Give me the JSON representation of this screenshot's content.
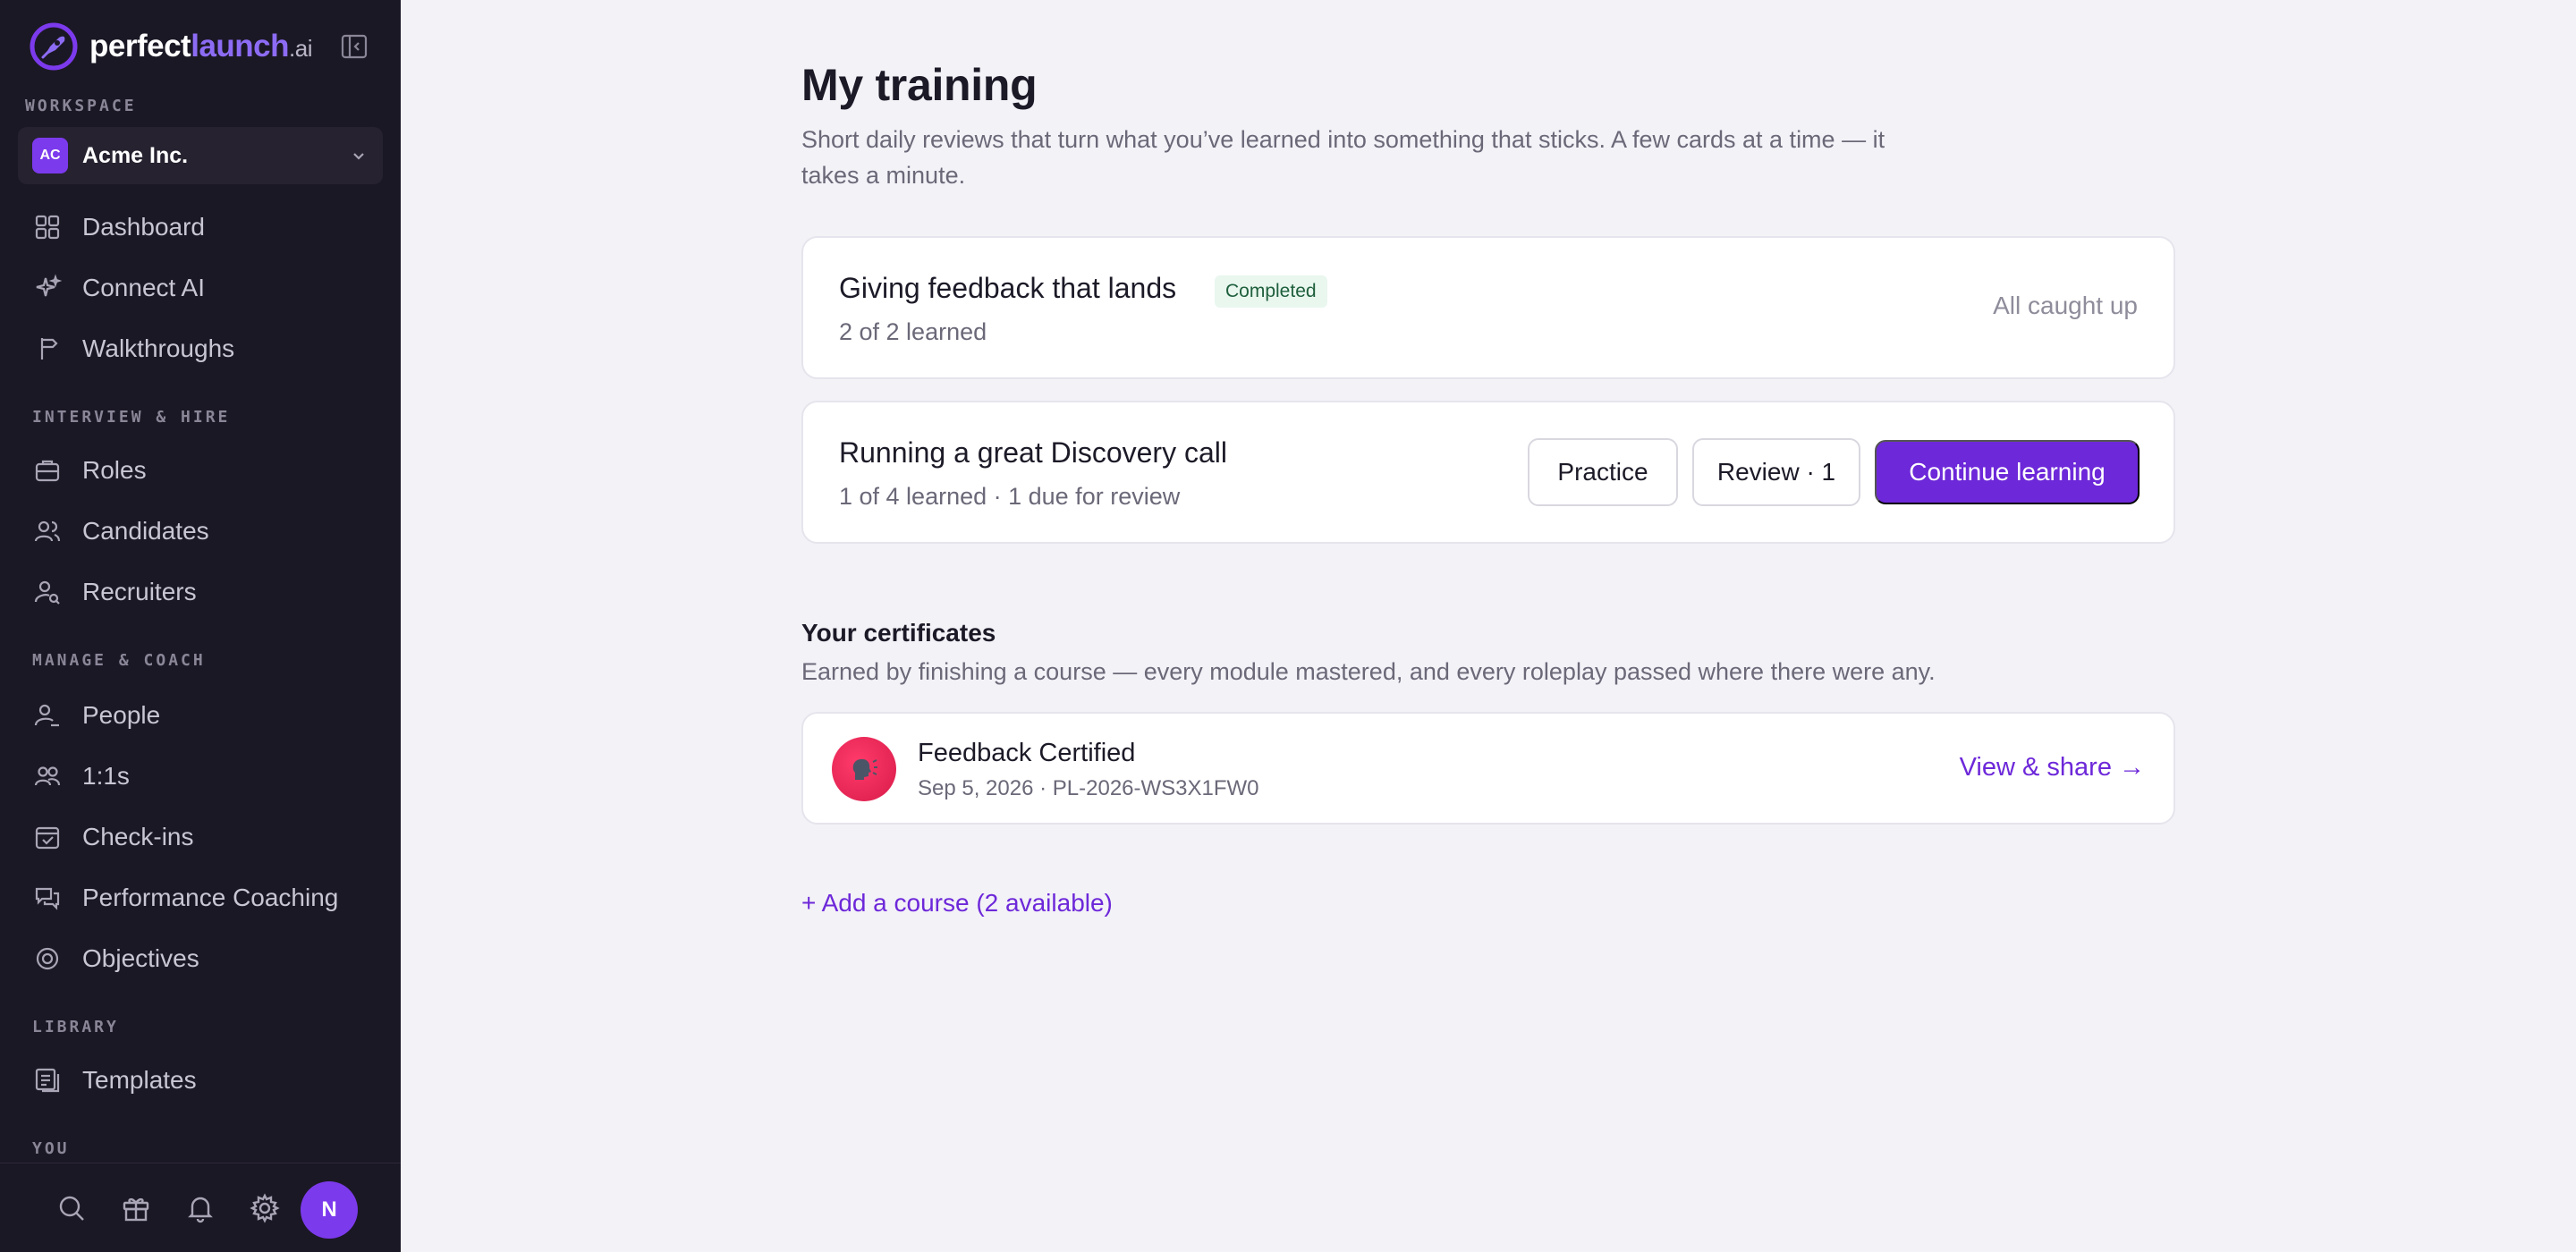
{
  "brand": {
    "name_main": "perfect",
    "name_accent": "launch",
    "name_suffix": ".ai",
    "accent_color": "#7c3aed"
  },
  "sidebar": {
    "workspace_label": "WORKSPACE",
    "workspace": {
      "initials": "AC",
      "name": "Acme Inc."
    },
    "sections": {
      "interview": "INTERVIEW & HIRE",
      "manage": "MANAGE & COACH",
      "library": "LIBRARY",
      "you": "YOU"
    },
    "items": {
      "dashboard": "Dashboard",
      "connect_ai": "Connect AI",
      "walkthroughs": "Walkthroughs",
      "roles": "Roles",
      "candidates": "Candidates",
      "recruiters": "Recruiters",
      "people": "People",
      "one_on_ones": "1:1s",
      "checkins": "Check-ins",
      "performance": "Performance Coaching",
      "objectives": "Objectives",
      "templates": "Templates"
    },
    "footer": {
      "avatar_initial": "N"
    }
  },
  "main": {
    "title": "My training",
    "subtitle": "Short daily reviews that turn what you’ve learned into something that sticks. A few cards at a time — it takes a minute.",
    "courses": [
      {
        "title": "Giving feedback that lands",
        "badge": "Completed",
        "progress": "2 of 2 learned",
        "status": "All caught up"
      },
      {
        "title": "Running a great Discovery call",
        "progress": "1 of 4 learned · 1 due for review",
        "practice_label": "Practice",
        "review_label": "Review · 1",
        "continue_label": "Continue learning"
      }
    ],
    "certificates": {
      "title": "Your certificates",
      "subtitle": "Earned by finishing a course — every module mastered, and every roleplay passed where there were any.",
      "items": [
        {
          "title": "Feedback Certified",
          "meta": "Sep 5, 2026 · PL-2026-WS3X1FW0",
          "link": "View & share →",
          "icon": "speaking-head-icon"
        }
      ]
    },
    "add_course": "+ Add a course (2 available)"
  }
}
